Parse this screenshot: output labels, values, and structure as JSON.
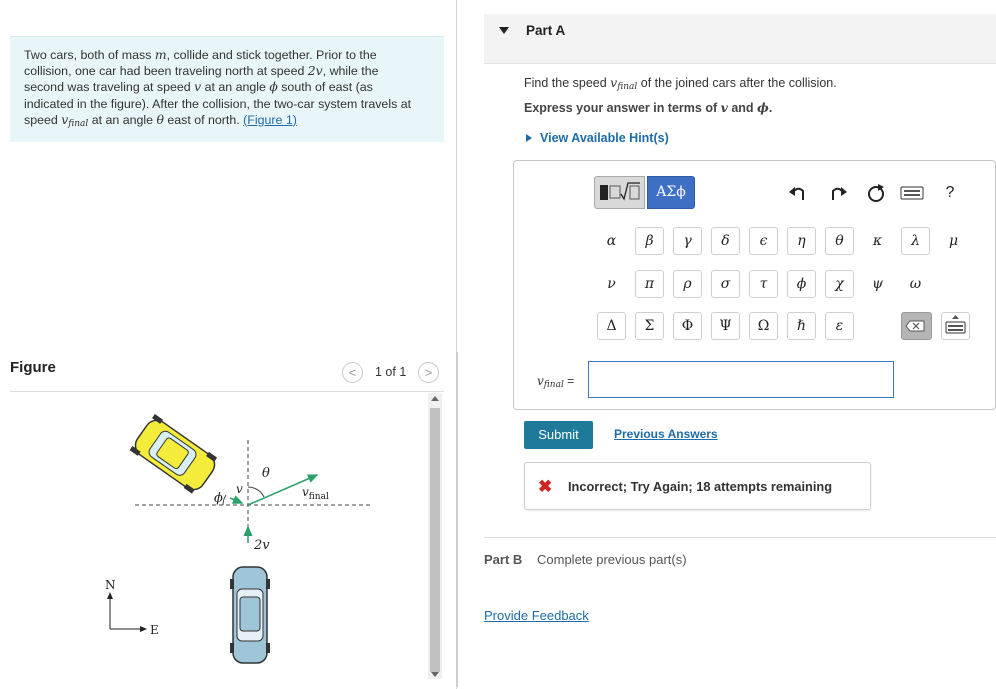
{
  "problem": {
    "line1_a": "Two cars, both of mass ",
    "line1_mass": "m",
    "line1_b": ", collide and stick together. Prior to the",
    "line2": "collision, one car had been traveling north at speed ",
    "line2_speed": "2v",
    "line2_b": ", while the",
    "line3_a": "second was traveling at speed ",
    "line3_v": "v",
    "line3_b": " at an angle ",
    "line3_phi": "ϕ",
    "line3_c": " south of east (as",
    "line4": "indicated in the figure). After the collision, the two-car system travels at",
    "line5_a": "speed ",
    "line5_v": "v",
    "line5_sub": "final",
    "line5_b": " at an angle ",
    "line5_theta": "θ",
    "line5_c": " east of north. ",
    "figure_link": "(Figure 1)"
  },
  "figure": {
    "heading": "Figure",
    "pager": "1 of 1",
    "prev_symbol": "<",
    "next_symbol": ">",
    "labels": {
      "theta": "θ",
      "v": "v",
      "phi": "ϕ",
      "vfinal_v": "v",
      "vfinal_sub": "final",
      "two_v": "2v",
      "north": "N",
      "east": "E"
    }
  },
  "part_a": {
    "title": "Part A",
    "question_a": "Find the speed ",
    "question_v": "v",
    "question_sub": "final",
    "question_b": " of the joined cars after the collision.",
    "express_a": "Express your answer in terms of ",
    "express_v": "v",
    "express_b": " and ",
    "express_phi": "ϕ",
    "express_c": ".",
    "hint_link": "View Available Hint(s)",
    "toolbar": {
      "greek_label": "ΑΣϕ",
      "help": "?"
    },
    "greek_row1": [
      "α",
      "β",
      "γ",
      "δ",
      "ϵ",
      "η",
      "θ",
      "κ",
      "λ",
      "μ"
    ],
    "greek_row2": [
      "ν",
      "π",
      "ρ",
      "σ",
      "τ",
      "ϕ",
      "χ",
      "ψ",
      "ω"
    ],
    "greek_row3": [
      "Δ",
      "Σ",
      "Φ",
      "Ψ",
      "Ω",
      "ℏ",
      "ε"
    ],
    "input_label_v": "v",
    "input_label_sub": "final",
    "input_label_eq": " =",
    "input_value": "",
    "submit": "Submit",
    "previous_answers": "Previous Answers",
    "feedback_icon": "✖",
    "feedback": "Incorrect; Try Again; 18 attempts remaining"
  },
  "part_b": {
    "label": "Part B",
    "status": "Complete previous part(s)"
  },
  "provide_feedback": "Provide Feedback"
}
